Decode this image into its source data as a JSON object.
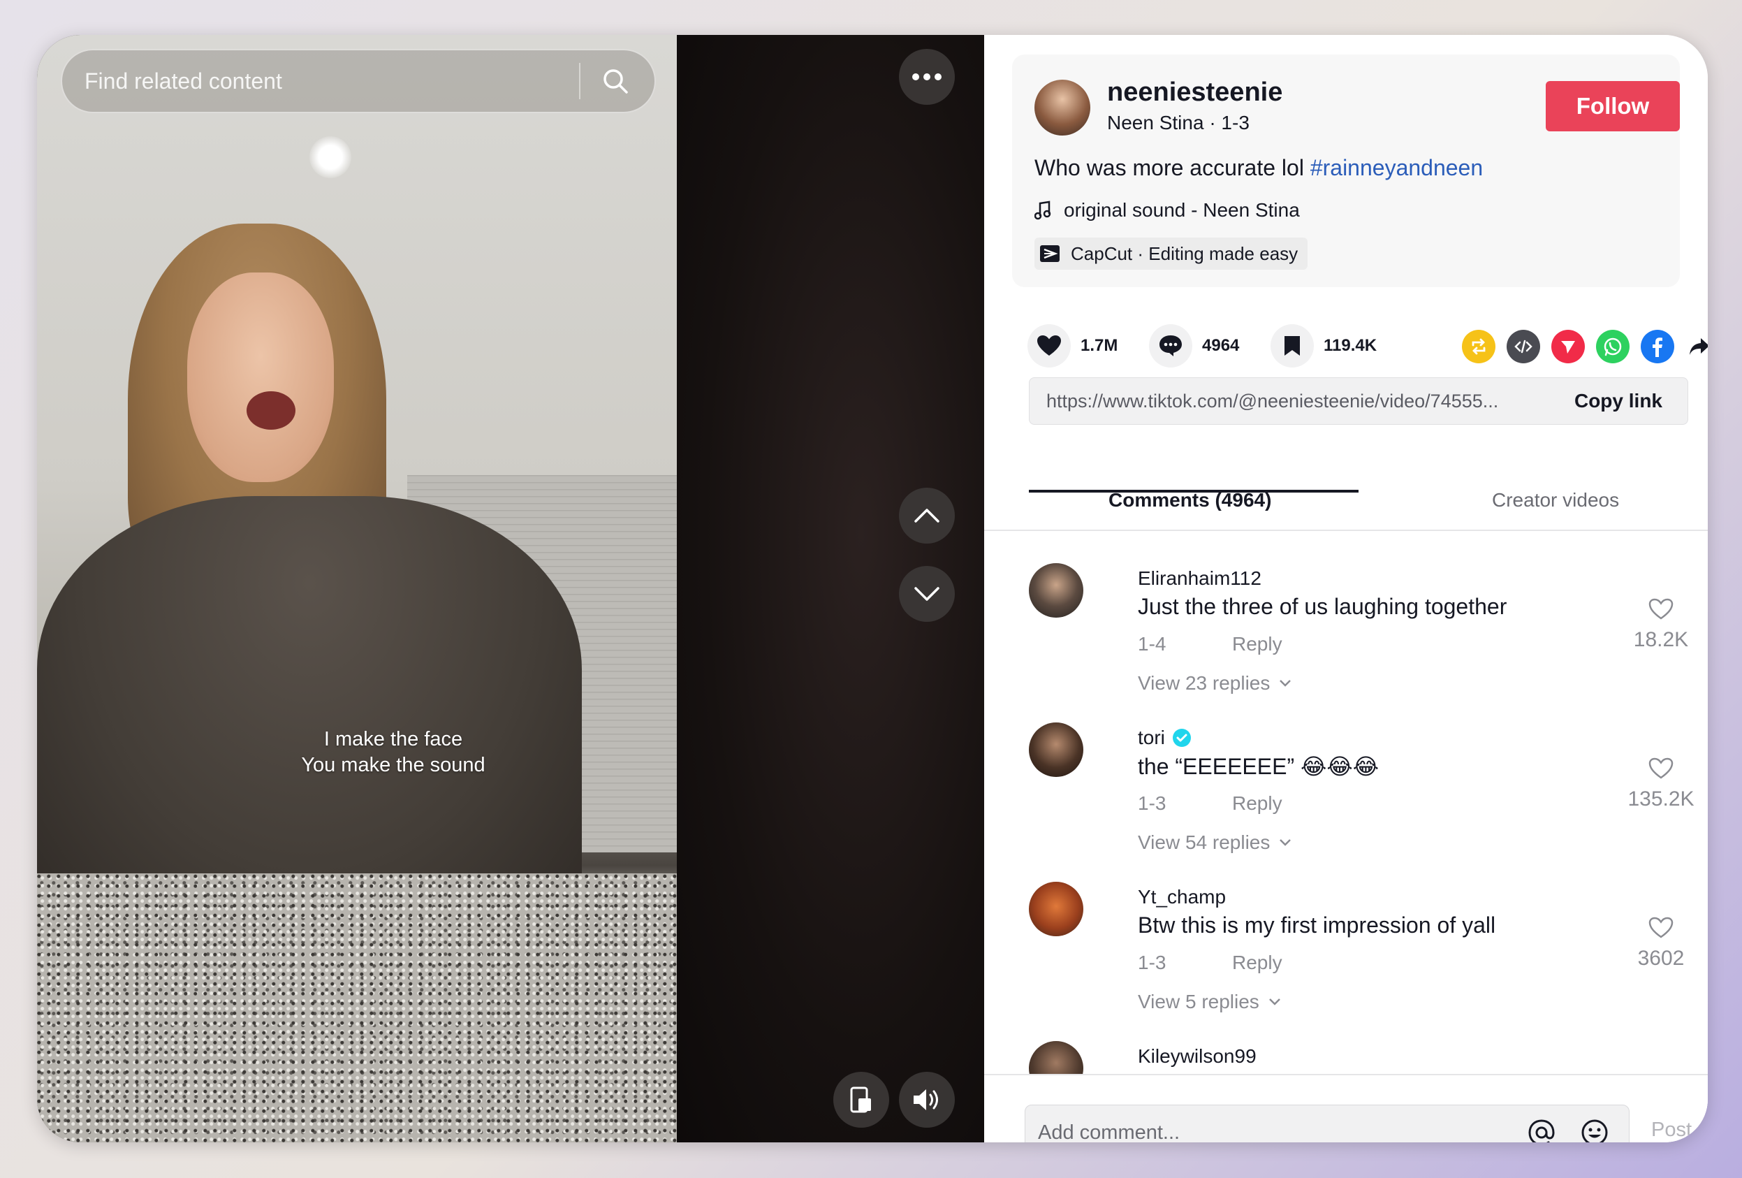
{
  "search": {
    "placeholder": "Find related content"
  },
  "video": {
    "caption_line1": "I make the face",
    "caption_line2": "You make the sound"
  },
  "post": {
    "author_username": "neeniesteenie",
    "author_display": "Neen Stina · 1-3",
    "follow_label": "Follow",
    "description": "Who was more accurate lol ",
    "hashtag": "#rainneyandneen",
    "sound": "original sound - Neen Stina",
    "capcut": "CapCut · Editing made easy"
  },
  "stats": {
    "likes": "1.7M",
    "comments": "4964",
    "saves": "119.4K"
  },
  "link": {
    "url": "https://www.tiktok.com/@neeniesteenie/video/74555...",
    "copy_label": "Copy link"
  },
  "tabs": {
    "comments": "Comments (4964)",
    "creator": "Creator videos"
  },
  "comments": [
    {
      "user": "Eliranhaim112",
      "text": "Just the three of us laughing together",
      "date": "1-4",
      "reply": "Reply",
      "likes": "18.2K",
      "view": "View 23 replies"
    },
    {
      "user": "tori",
      "text": "the “EEEEEEE” 😂😂😂",
      "date": "1-3",
      "reply": "Reply",
      "likes": "135.2K",
      "view": "View 54 replies"
    },
    {
      "user": "Yt_champ",
      "text": "Btw this is my first impression of yall",
      "date": "1-3",
      "reply": "Reply",
      "likes": "3602",
      "view": "View 5 replies"
    },
    {
      "user": "Kileywilson99"
    }
  ],
  "footer": {
    "placeholder": "Add comment...",
    "post_label": "Post"
  },
  "colors": {
    "follow": "#ea4359",
    "hashtag": "#2b5db9",
    "verified": "#20d5ec"
  }
}
